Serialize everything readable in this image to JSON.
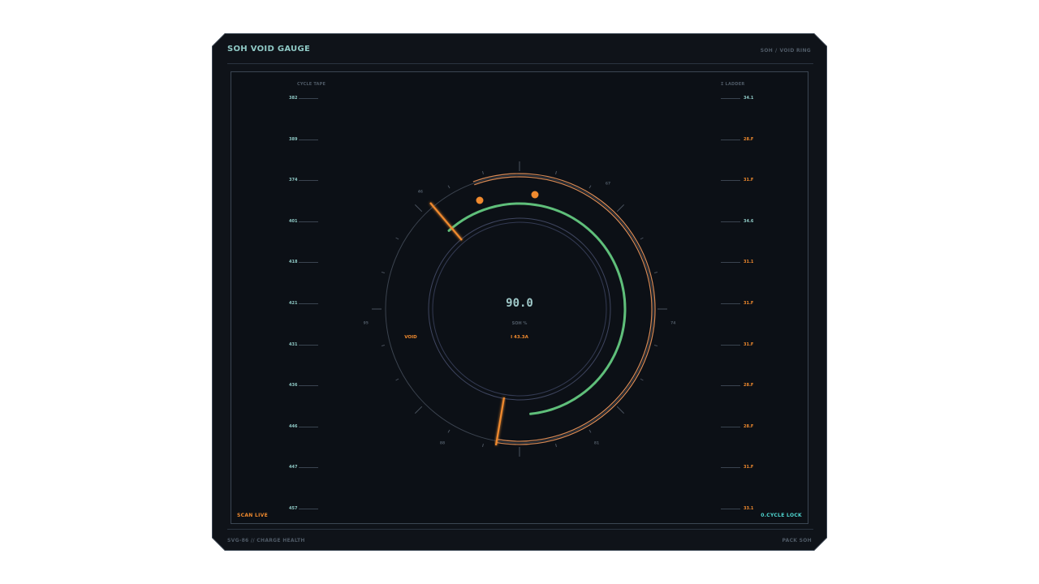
{
  "header": {
    "title": "SOH VOID GAUGE",
    "crumb_a": "SOH",
    "crumb_sep": "/",
    "crumb_b": "VOID RING"
  },
  "footer": {
    "left_a": "SVG-86",
    "left_sep": "//",
    "left_b": "CHARGE HEALTH",
    "right": "PACK SOH"
  },
  "status": {
    "scan": "SCAN LIVE",
    "lock": "0.CYCLE LOCK"
  },
  "left_tape": {
    "title": "CYCLE TAPE",
    "ticks": [
      "382",
      "389",
      "374",
      "401",
      "418",
      "421",
      "431",
      "436",
      "446",
      "447",
      "457"
    ]
  },
  "right_tape": {
    "title": "Σ LADDER",
    "ticks": [
      "34.1",
      "28.F",
      "31.F",
      "34.6",
      "31.1",
      "31.F",
      "31.F",
      "28.F",
      "28.F",
      "31.F",
      "33.1"
    ]
  },
  "gauge": {
    "value": "90.0",
    "value_label": "SOH %",
    "void_label": "VOID",
    "current": "I 43.3A",
    "soh_percent": 90.0,
    "ring_labels": [
      "46",
      "67",
      "74",
      "81",
      "88",
      "95"
    ],
    "colors": {
      "accent": "#f08a2e",
      "health": "#5fbf7a",
      "value": "#9fc8c8"
    }
  }
}
